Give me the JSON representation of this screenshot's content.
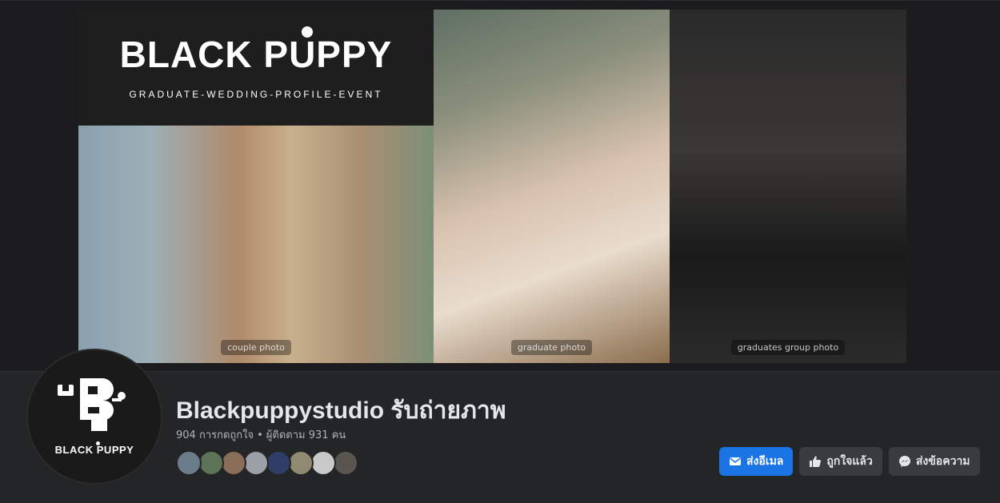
{
  "cover": {
    "brand_wordmark": "BLACK PUPPY",
    "brand_tagline": "GRADUATE-WEDDING-PROFILE-EVENT",
    "photos": [
      {
        "label": "couple photo"
      },
      {
        "label": "graduate photo"
      },
      {
        "label": "graduates group photo"
      }
    ]
  },
  "avatar": {
    "text": "BLACK PUPPY"
  },
  "page": {
    "name": "Blackpuppystudio รับถ่ายภาพ",
    "likes": "904 การกดถูกใจ",
    "separator": "•",
    "followers": "ผู้ติดตาม 931 คน"
  },
  "friends": [
    {
      "color": "#6b7c8a"
    },
    {
      "color": "#5d7356"
    },
    {
      "color": "#8a6e57"
    },
    {
      "color": "#9aa0a6"
    },
    {
      "color": "#2f3e66"
    },
    {
      "color": "#8f8a70"
    },
    {
      "color": "#c9c9c9"
    },
    {
      "color": "#5a554f"
    }
  ],
  "actions": {
    "email_label": "ส่งอีเมล",
    "liked_label": "ถูกใจแล้ว",
    "message_label": "ส่งข้อความ"
  },
  "colors": {
    "accent": "#1b74e4",
    "background": "#18191a",
    "surface": "#242526"
  },
  "icons": {
    "email": "envelope-icon",
    "liked": "thumbs-up-icon",
    "message": "messenger-icon"
  }
}
